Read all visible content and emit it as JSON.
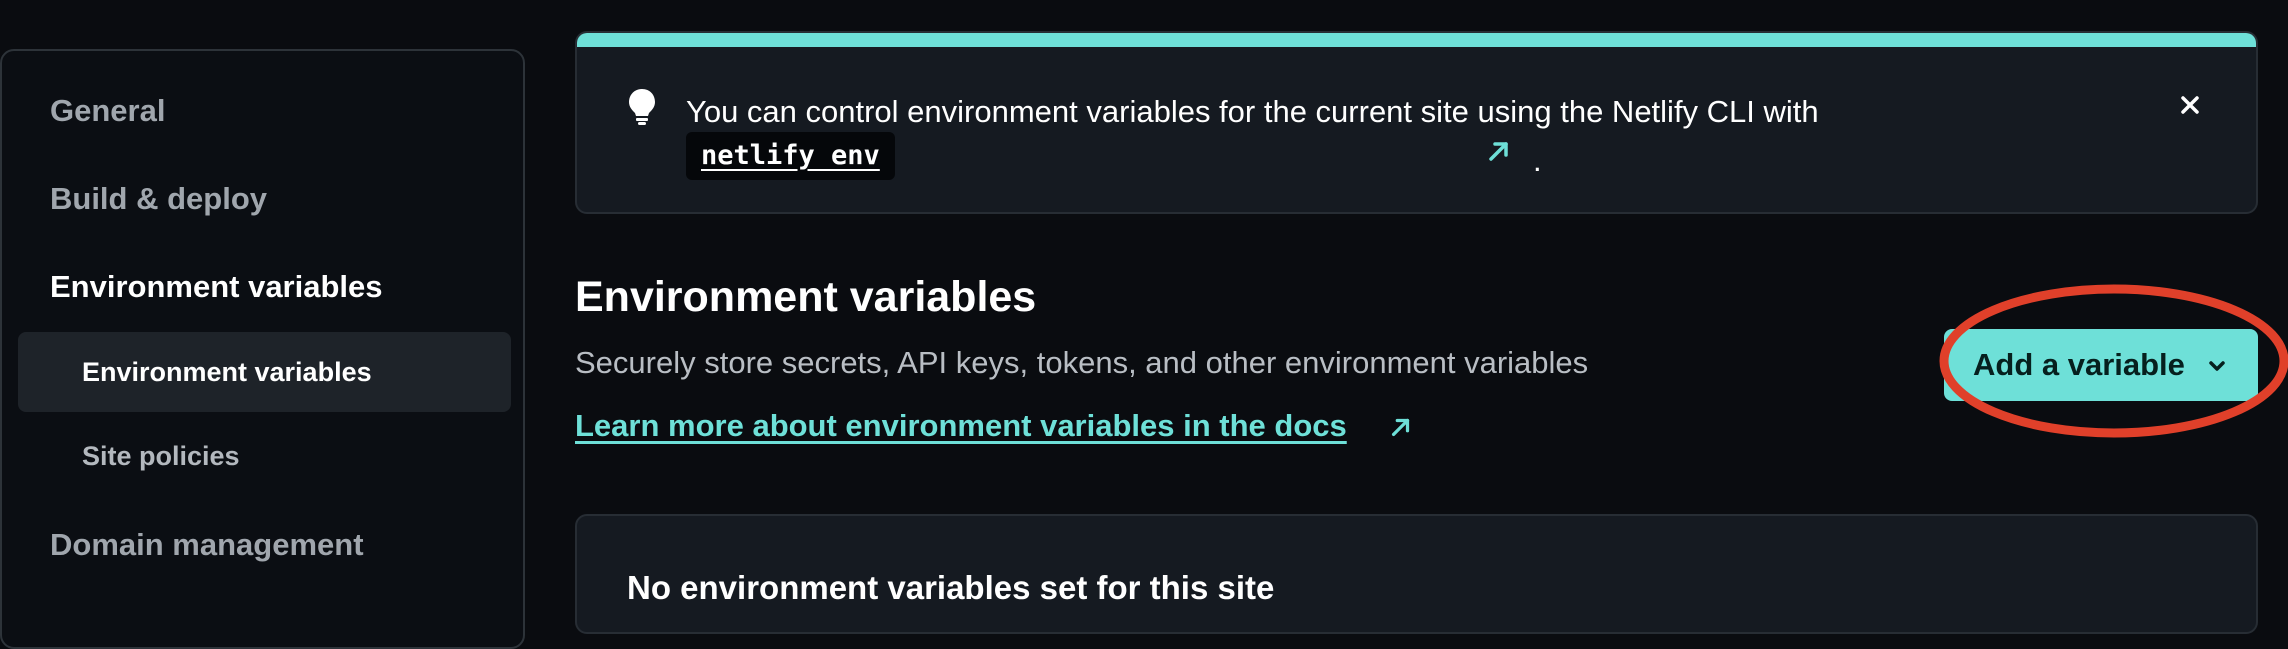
{
  "sidebar": {
    "items": [
      {
        "label": "General"
      },
      {
        "label": "Build & deploy"
      },
      {
        "label": "Environment variables"
      },
      {
        "label": "Domain management"
      }
    ],
    "subitems": [
      {
        "label": "Environment variables"
      },
      {
        "label": "Site policies"
      }
    ]
  },
  "banner": {
    "text": "You can control environment variables for the current site using the Netlify CLI with",
    "code": "netlify env",
    "period": ".",
    "icon": "lightbulb-icon",
    "close_icon": "close-icon"
  },
  "main": {
    "title": "Environment variables",
    "description": "Securely store secrets, API keys, tokens, and other environment variables",
    "docs_link": "Learn more about environment variables in the docs",
    "add_button": "Add a variable",
    "empty_state": "No environment variables set for this site"
  },
  "colors": {
    "accent": "#6ee0d8",
    "background": "#0a0c10",
    "card": "#151a21",
    "highlight": "#e0402a"
  }
}
